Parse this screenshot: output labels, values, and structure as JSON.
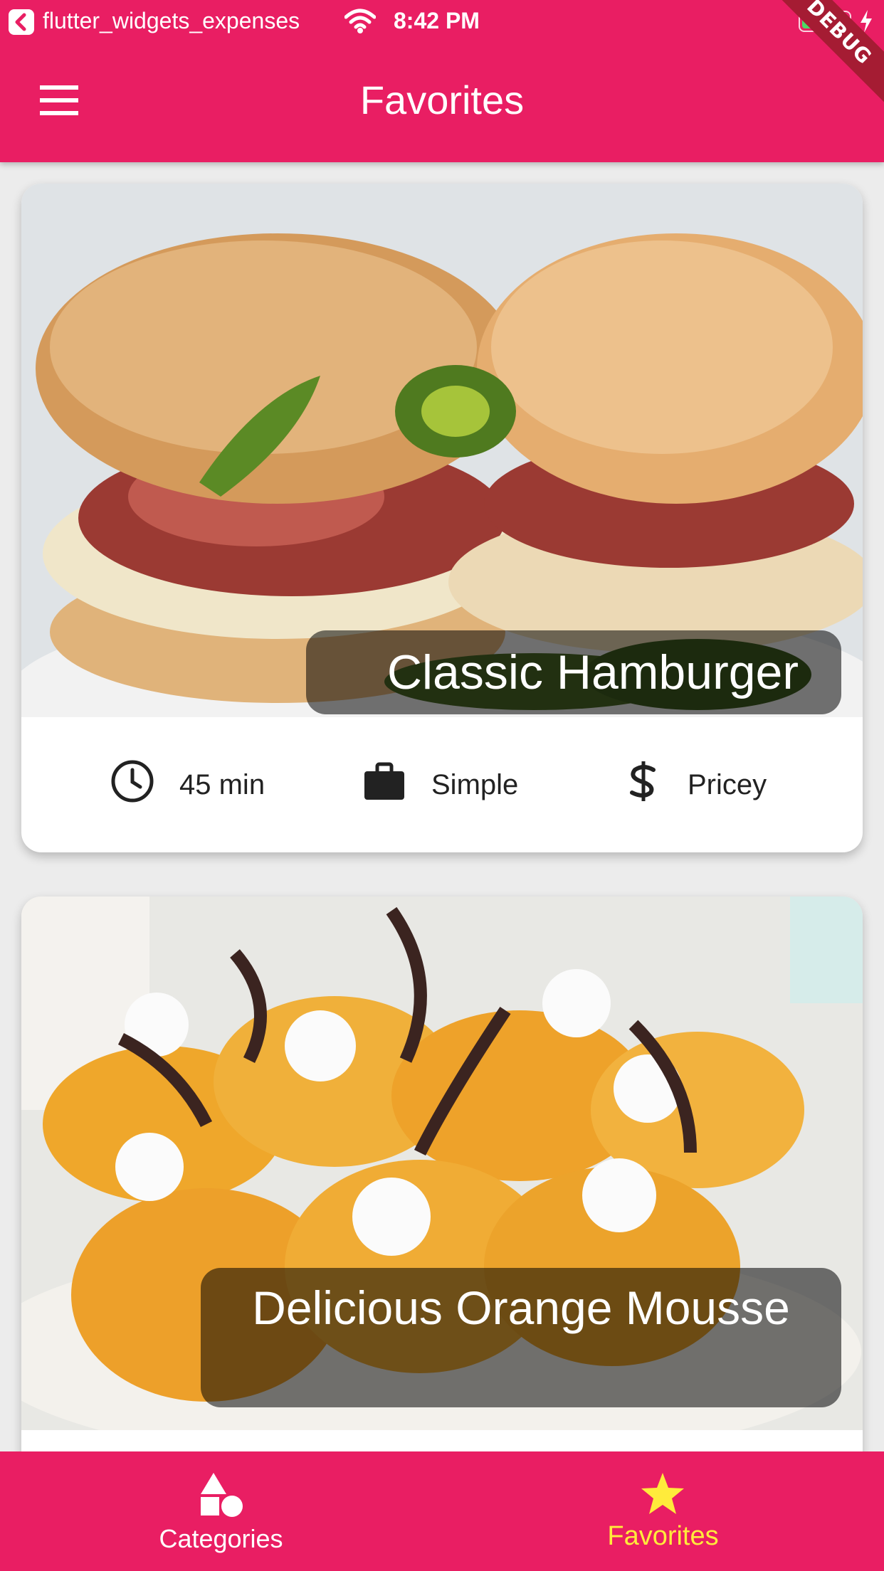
{
  "status_bar": {
    "app_name": "flutter_widgets_expenses",
    "time": "8:42 PM",
    "icons": [
      "back-arrow-icon",
      "wifi-icon",
      "battery-icon",
      "charging-bolt-icon"
    ]
  },
  "debug_banner": "DEBUG",
  "app_bar": {
    "title": "Favorites",
    "menu_icon": "hamburger-menu-icon"
  },
  "meals": [
    {
      "title": "Classic Hamburger",
      "duration": "45 min",
      "complexity": "Simple",
      "affordability": "Pricey"
    },
    {
      "title": "Delicious Orange Mousse"
    }
  ],
  "bottom_nav": {
    "tabs": [
      {
        "label": "Categories",
        "icon": "categories-shapes-icon",
        "selected": false
      },
      {
        "label": "Favorites",
        "icon": "star-icon",
        "selected": true
      }
    ]
  },
  "colors": {
    "primary": "#e91e63",
    "accent": "#ffeb3b",
    "overlay": "rgba(0,0,0,0.54)"
  }
}
